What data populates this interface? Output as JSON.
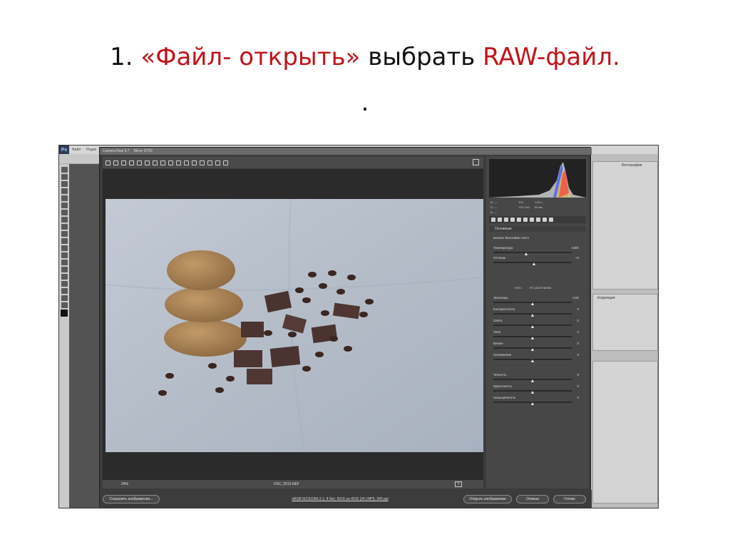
{
  "slide": {
    "title_num": "1.",
    "title_accent1": "«Файл- открыть»",
    "title_mid": "выбрать",
    "title_accent2": "RAW-файл.",
    "title_dot": "."
  },
  "photoshop": {
    "logo": "Ps",
    "menu": [
      "Файл",
      "Редак",
      "Camera Raw 9.7",
      "Nikon D750"
    ]
  },
  "camera_raw": {
    "zoom": "24%",
    "filename": "DSC_0615.NEF",
    "status_button": "Y",
    "info_link": "sRGB IEC61966-2.1; 8 бит; 6016 на 4016 (24,1МП); 300 ppi",
    "save_button": "Сохранить изображение...",
    "open_button": "Открыть изображение",
    "cancel_button": "Отмена",
    "done_button": "Готово",
    "histogram_readout": {
      "r": "R:",
      "g": "G:",
      "b": "B:",
      "r_val": "—",
      "g_val": "—",
      "b_val": "—",
      "f": "f/11",
      "s": "1/15 с",
      "iso": "ISO 100",
      "mm": "50 мм"
    },
    "panel_section": "Основные",
    "wb_label": "Баланс белого:",
    "wb_value": "Как снято",
    "auto_label": "Авто",
    "default_label": "По умолчанию",
    "sliders": [
      {
        "label": "Температура",
        "value": "4300",
        "pos": 0.42
      },
      {
        "label": "Оттенок",
        "value": "+3",
        "pos": 0.52
      },
      {
        "label": "Экспонир.",
        "value": "0,00",
        "pos": 0.5
      },
      {
        "label": "Контрастность",
        "value": "0",
        "pos": 0.5
      },
      {
        "label": "Света",
        "value": "0",
        "pos": 0.5
      },
      {
        "label": "Тени",
        "value": "0",
        "pos": 0.5
      },
      {
        "label": "Белые",
        "value": "0",
        "pos": 0.5
      },
      {
        "label": "Затемнение",
        "value": "0",
        "pos": 0.5
      },
      {
        "label": "Четкость",
        "value": "0",
        "pos": 0.5
      },
      {
        "label": "Красочность",
        "value": "0",
        "pos": 0.5
      },
      {
        "label": "Насыщенность",
        "value": "0",
        "pos": 0.5
      }
    ]
  },
  "right_dock": {
    "panel1_tab": "Фотография",
    "panel2_tab": "Коррекция"
  },
  "colors": {
    "accent_red": "#c0141a",
    "cr_bg": "#3c3c3c",
    "photo_bg": "#b7c0cc"
  }
}
